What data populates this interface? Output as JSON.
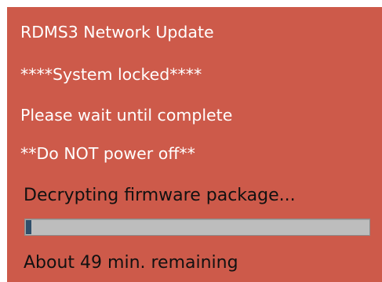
{
  "messages": {
    "title": "RDMS3 Network Update",
    "locked": "****System locked****",
    "wait": "Please wait until complete",
    "warning": "**Do NOT power off**"
  },
  "progress": {
    "status": "Decrypting firmware package...",
    "value_fraction": 0.01,
    "remaining": "About 49 min. remaining"
  },
  "colors": {
    "panel_background": "#cd5a4a",
    "message_text": "#ffffff",
    "status_text": "#111111",
    "bar_track": "#bdbdbd",
    "bar_fill": "#2f4f6b"
  }
}
